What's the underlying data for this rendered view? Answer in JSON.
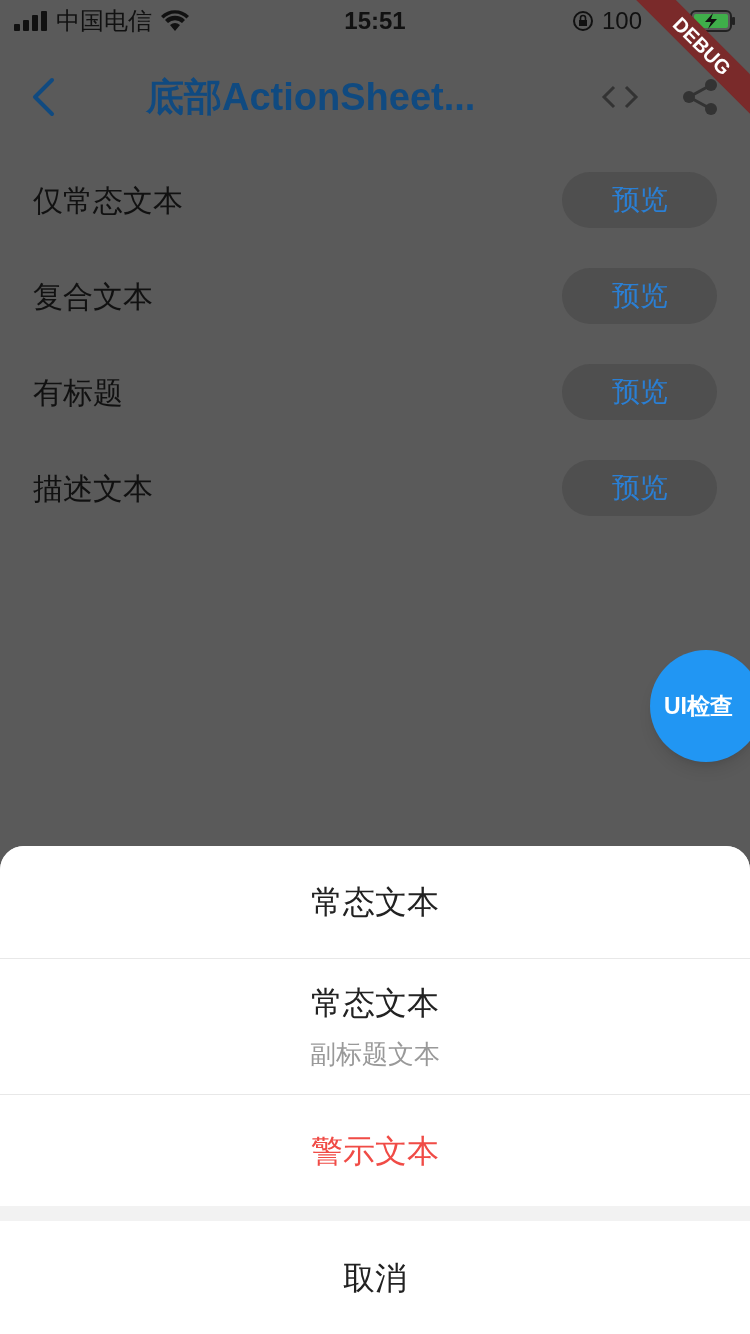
{
  "status_bar": {
    "carrier": "中国电信",
    "time": "15:51",
    "battery": "100"
  },
  "debug_banner": "DEBUG",
  "nav": {
    "title": "底部ActionSheet..."
  },
  "rows": [
    {
      "label": "仅常态文本",
      "button": "预览"
    },
    {
      "label": "复合文本",
      "button": "预览"
    },
    {
      "label": "有标题",
      "button": "预览"
    },
    {
      "label": "描述文本",
      "button": "预览"
    }
  ],
  "inspector_button": "UI检查",
  "action_sheet": {
    "items": [
      {
        "kind": "normal",
        "title": "常态文本"
      },
      {
        "kind": "normal",
        "title": "常态文本",
        "subtitle": "副标题文本"
      },
      {
        "kind": "warning",
        "title": "警示文本"
      }
    ],
    "cancel": "取消"
  }
}
